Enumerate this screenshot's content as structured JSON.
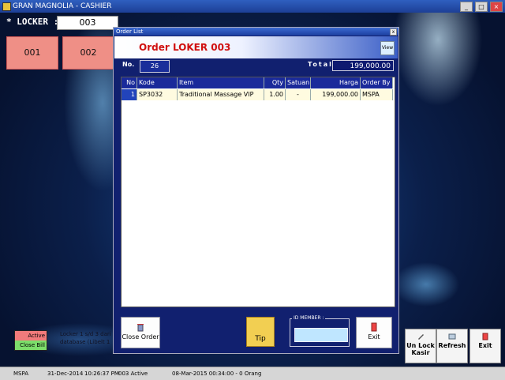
{
  "app": {
    "title": "GRAN MAGNOLIA - CASHIER"
  },
  "locker": {
    "label": "* LOCKER :",
    "input_value": "003",
    "buttons": [
      "001",
      "002"
    ]
  },
  "legend": {
    "active": "Active",
    "close_bill": "Close Bill",
    "info_line1": "Locker 1 s/d 3 dari",
    "info_line2": "database (Libelt 1"
  },
  "dialog": {
    "title": "Order List",
    "close": "x",
    "header": "Order LOKER 003",
    "view_label": "View",
    "no_label": "No.",
    "no_value": "26",
    "total_label": "Total",
    "total_value": "199,000.00",
    "columns": [
      "No",
      "Kode",
      "Item",
      "Qty",
      "Satuan",
      "Harga",
      "Order By"
    ],
    "rows": [
      {
        "no": "1",
        "kode": "SP3032",
        "item": "Traditional Massage VIP",
        "qty": "1.00",
        "satuan": "-",
        "harga": "199,000.00",
        "order_by": "MSPA"
      }
    ],
    "close_order_label": "Close Order",
    "tip_label": "Tip",
    "id_member_label": "ID MEMBER :",
    "id_member_value": "",
    "exit_label": "Exit"
  },
  "right_buttons": {
    "unlock": "Un Lock Kasir",
    "refresh": "Refresh",
    "exit": "Exit"
  },
  "statusbar": {
    "user": "MSPA",
    "date": "31-Dec-2014",
    "time": "10:26:37 PM",
    "locker_status": "003 Active",
    "session": "08-Mar-2015 00:34:00 - 0 Orang"
  },
  "colors": {
    "locker_button": "#ef8f86",
    "header_text": "#d01010",
    "grid_header": "#1a2a9a",
    "dialog_bg": "#11206f"
  }
}
